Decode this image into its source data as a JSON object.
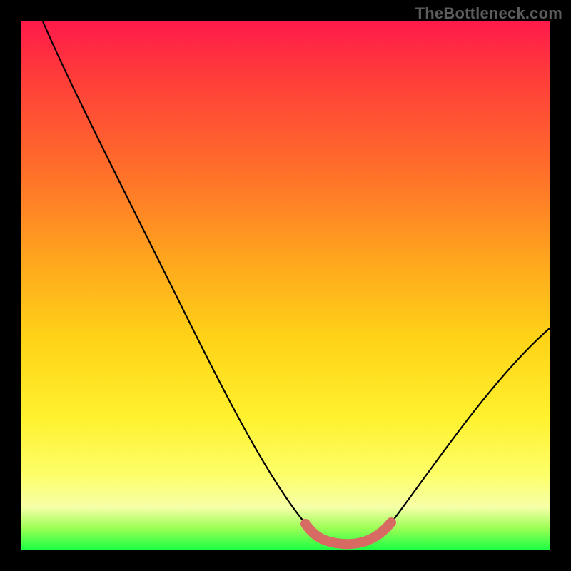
{
  "watermark": "TheBottleneck.com",
  "colors": {
    "background": "#000000",
    "gradient_top": "#ff1a4a",
    "gradient_bid": "#ffd317",
    "gradient_bottom": "#1cff44",
    "curve": "#000000",
    "highlight": "#d86a64"
  },
  "chart_data": {
    "type": "line",
    "title": "",
    "xlabel": "",
    "ylabel": "",
    "xlim": [
      0,
      100
    ],
    "ylim": [
      0,
      100
    ],
    "series": [
      {
        "name": "bottleneck-curve",
        "x": [
          4,
          10,
          20,
          30,
          40,
          48,
          54,
          58,
          62,
          66,
          70,
          80,
          90,
          100
        ],
        "y": [
          100,
          90,
          74,
          58,
          40,
          22,
          8,
          2,
          0,
          0,
          2,
          18,
          38,
          58
        ]
      }
    ],
    "highlight_segment": {
      "name": "optimal-range",
      "x": [
        54,
        58,
        62,
        66,
        70
      ],
      "y": [
        6,
        1.5,
        0.5,
        0.5,
        2
      ]
    }
  }
}
